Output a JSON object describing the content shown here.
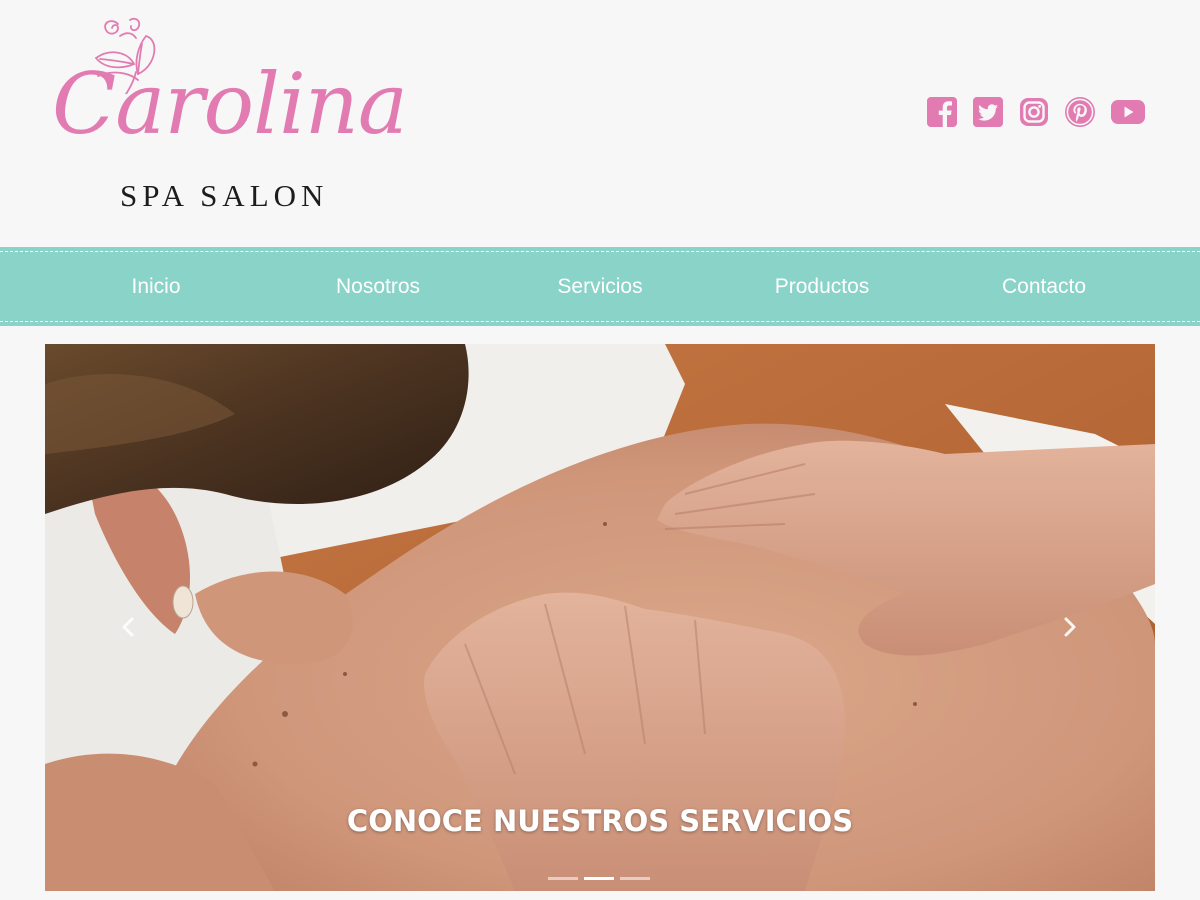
{
  "brand": {
    "name": "Carolina",
    "subtitle": "SPA SALON",
    "accent_color": "#e27bb1"
  },
  "social": [
    {
      "icon": "facebook-icon"
    },
    {
      "icon": "twitter-icon"
    },
    {
      "icon": "instagram-icon"
    },
    {
      "icon": "pinterest-icon"
    },
    {
      "icon": "youtube-icon"
    }
  ],
  "nav": {
    "background": "#89d3c8",
    "items": [
      {
        "label": "Inicio"
      },
      {
        "label": "Nosotros"
      },
      {
        "label": "Servicios"
      },
      {
        "label": "Productos"
      },
      {
        "label": "Contacto"
      }
    ]
  },
  "carousel": {
    "caption": "CONOCE NUESTROS SERVICIOS",
    "slide_count": 3,
    "active_slide": 2
  }
}
